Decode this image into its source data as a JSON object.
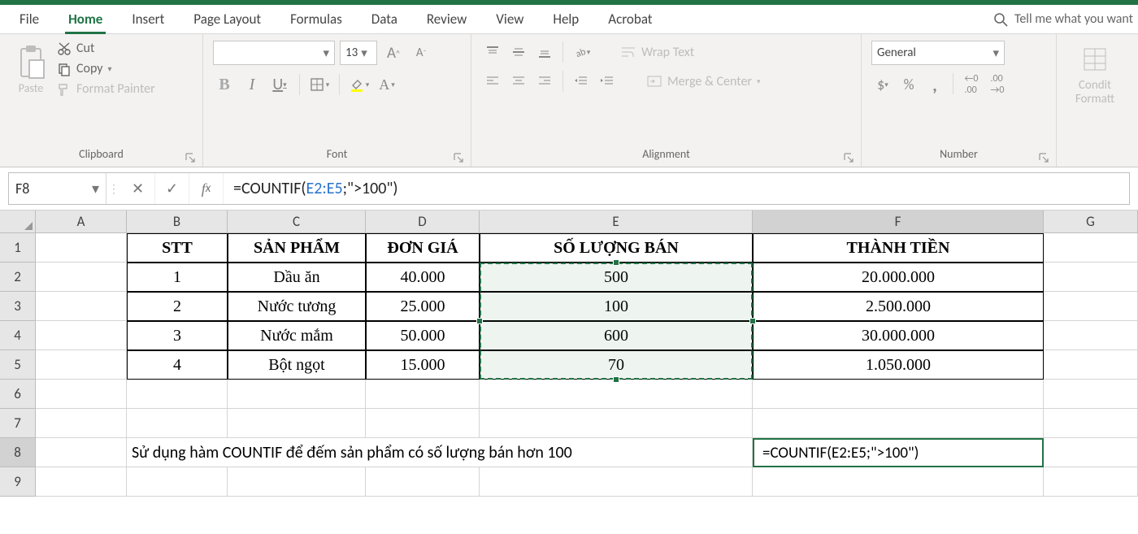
{
  "tabs": {
    "file": "File",
    "home": "Home",
    "insert": "Insert",
    "page_layout": "Page Layout",
    "formulas": "Formulas",
    "data": "Data",
    "review": "Review",
    "view": "View",
    "help": "Help",
    "acrobat": "Acrobat",
    "tellme": "Tell me what you want"
  },
  "ribbon": {
    "clipboard": {
      "label": "Clipboard",
      "paste": "Paste",
      "cut": "Cut",
      "copy": "Copy",
      "format_painter": "Format Painter"
    },
    "font": {
      "label": "Font",
      "size": "13",
      "bold": "B",
      "italic": "I",
      "underline": "U",
      "grow": "A",
      "shrink": "A"
    },
    "alignment": {
      "label": "Alignment",
      "wrap": "Wrap Text",
      "merge": "Merge & Center"
    },
    "number": {
      "label": "Number",
      "format": "General",
      "currency": "$",
      "percent": "%",
      "comma": ","
    },
    "conditional": "Conditional Formatting"
  },
  "formula_bar": {
    "cell": "F8",
    "formula_prefix": "=COUNTIF(",
    "formula_range": "E2:E5",
    "formula_suffix": ";\">100\")"
  },
  "columns": [
    "A",
    "B",
    "C",
    "D",
    "E",
    "F",
    "G"
  ],
  "rows": [
    "1",
    "2",
    "3",
    "4",
    "5",
    "6",
    "7",
    "8",
    "9"
  ],
  "headers": {
    "b": "STT",
    "c": "SẢN PHẨM",
    "d": "ĐƠN GIÁ",
    "e": "SỐ LƯỢNG BÁN",
    "f": "THÀNH TIỀN"
  },
  "data": [
    {
      "stt": "1",
      "sp": "Dầu ăn",
      "gia": "40.000",
      "sl": "500",
      "tien": "20.000.000"
    },
    {
      "stt": "2",
      "sp": "Nước tương",
      "gia": "25.000",
      "sl": "100",
      "tien": "2.500.000"
    },
    {
      "stt": "3",
      "sp": "Nước mắm",
      "gia": "50.000",
      "sl": "600",
      "tien": "30.000.000"
    },
    {
      "stt": "4",
      "sp": "Bột ngọt",
      "gia": "15.000",
      "sl": "70",
      "tien": "1.050.000"
    }
  ],
  "note": "Sử dụng hàm COUNTIF để đếm sản phẩm có số lượng bán hơn 100",
  "active_formula": "=COUNTIF(E2:E5;\">100\")"
}
